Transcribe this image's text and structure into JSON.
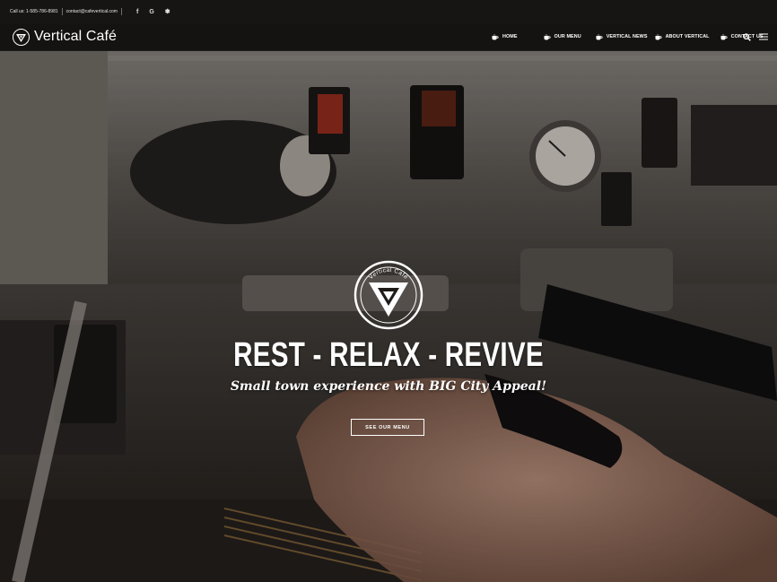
{
  "topbar": {
    "phone": "Call us: 1-585-786-8981",
    "email": "contact@cafevertical.com",
    "social": [
      {
        "icon": "facebook-icon",
        "glyph": "f"
      },
      {
        "icon": "google-icon",
        "glyph": "G"
      },
      {
        "icon": "yelp-icon",
        "glyph": "✽"
      }
    ]
  },
  "header": {
    "logo_text": "Vertical Café",
    "nav": [
      {
        "label": "HOME"
      },
      {
        "label": "OUR MENU"
      },
      {
        "label": "VERTICAL NEWS"
      },
      {
        "label": "ABOUT VERTICAL"
      },
      {
        "label": "CONTACT US"
      }
    ],
    "icons": [
      "search-icon",
      "menu-icon"
    ]
  },
  "hero": {
    "emblem_text": "Vertical Café",
    "headline": "REST - RELAX - REVIVE",
    "tagline": "Small town experience with BIG City Appeal!",
    "cta_label": "SEE OUR MENU"
  },
  "colors": {
    "bar_bg": "#161514",
    "text": "#ffffff"
  }
}
